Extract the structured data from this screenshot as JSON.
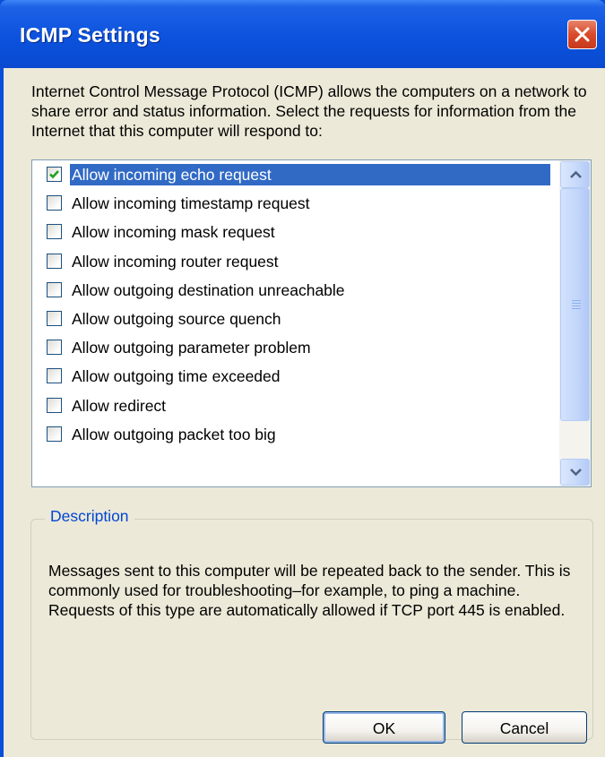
{
  "window": {
    "title": "ICMP Settings",
    "close_icon": "close-x-icon"
  },
  "intro_text": "Internet Control Message Protocol (ICMP) allows the computers on a network to share error and status information. Select the requests for information from the Internet that this computer will respond to:",
  "requests": [
    {
      "label": "Allow incoming echo request",
      "checked": true,
      "selected": true
    },
    {
      "label": "Allow incoming timestamp request",
      "checked": false,
      "selected": false
    },
    {
      "label": "Allow incoming mask request",
      "checked": false,
      "selected": false
    },
    {
      "label": "Allow incoming router request",
      "checked": false,
      "selected": false
    },
    {
      "label": "Allow outgoing destination unreachable",
      "checked": false,
      "selected": false
    },
    {
      "label": "Allow outgoing source quench",
      "checked": false,
      "selected": false
    },
    {
      "label": "Allow outgoing parameter problem",
      "checked": false,
      "selected": false
    },
    {
      "label": "Allow outgoing time exceeded",
      "checked": false,
      "selected": false
    },
    {
      "label": "Allow redirect",
      "checked": false,
      "selected": false
    },
    {
      "label": "Allow outgoing packet too big",
      "checked": false,
      "selected": false
    }
  ],
  "description": {
    "label": "Description",
    "text": "Messages sent to this computer will be repeated back to the sender. This is commonly used for troubleshooting–for example, to ping a machine. Requests of this type are automatically allowed if TCP port 445 is enabled."
  },
  "buttons": {
    "ok": "OK",
    "cancel": "Cancel"
  },
  "colors": {
    "title_bar": "#0a52dd",
    "selection": "#316ac5",
    "group_label": "#0046d5",
    "dialog_face": "#ece9d8"
  }
}
